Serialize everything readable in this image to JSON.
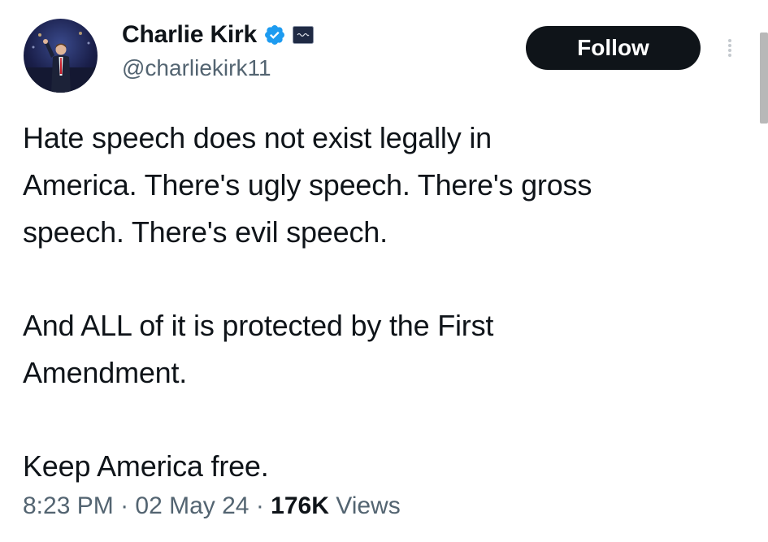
{
  "author": {
    "display_name": "Charlie Kirk",
    "handle": "@charliekirk11",
    "verified": true,
    "verified_color": "#1d9bf0"
  },
  "actions": {
    "follow_label": "Follow"
  },
  "tweet": {
    "paragraphs": [
      "Hate speech does not exist legally in\nAmerica. There's ugly speech. There's gross\nspeech. There's evil speech.",
      "And ALL of it is protected by the First\nAmendment.",
      "Keep America free."
    ]
  },
  "meta": {
    "time": "8:23 PM",
    "separator": " · ",
    "date": "02 May 24",
    "views_count": "176K",
    "views_label": " Views"
  },
  "icons": {
    "verified": "verified-badge-icon",
    "affiliate": "affiliate-org-icon",
    "more": "vertical-dots-icon"
  }
}
